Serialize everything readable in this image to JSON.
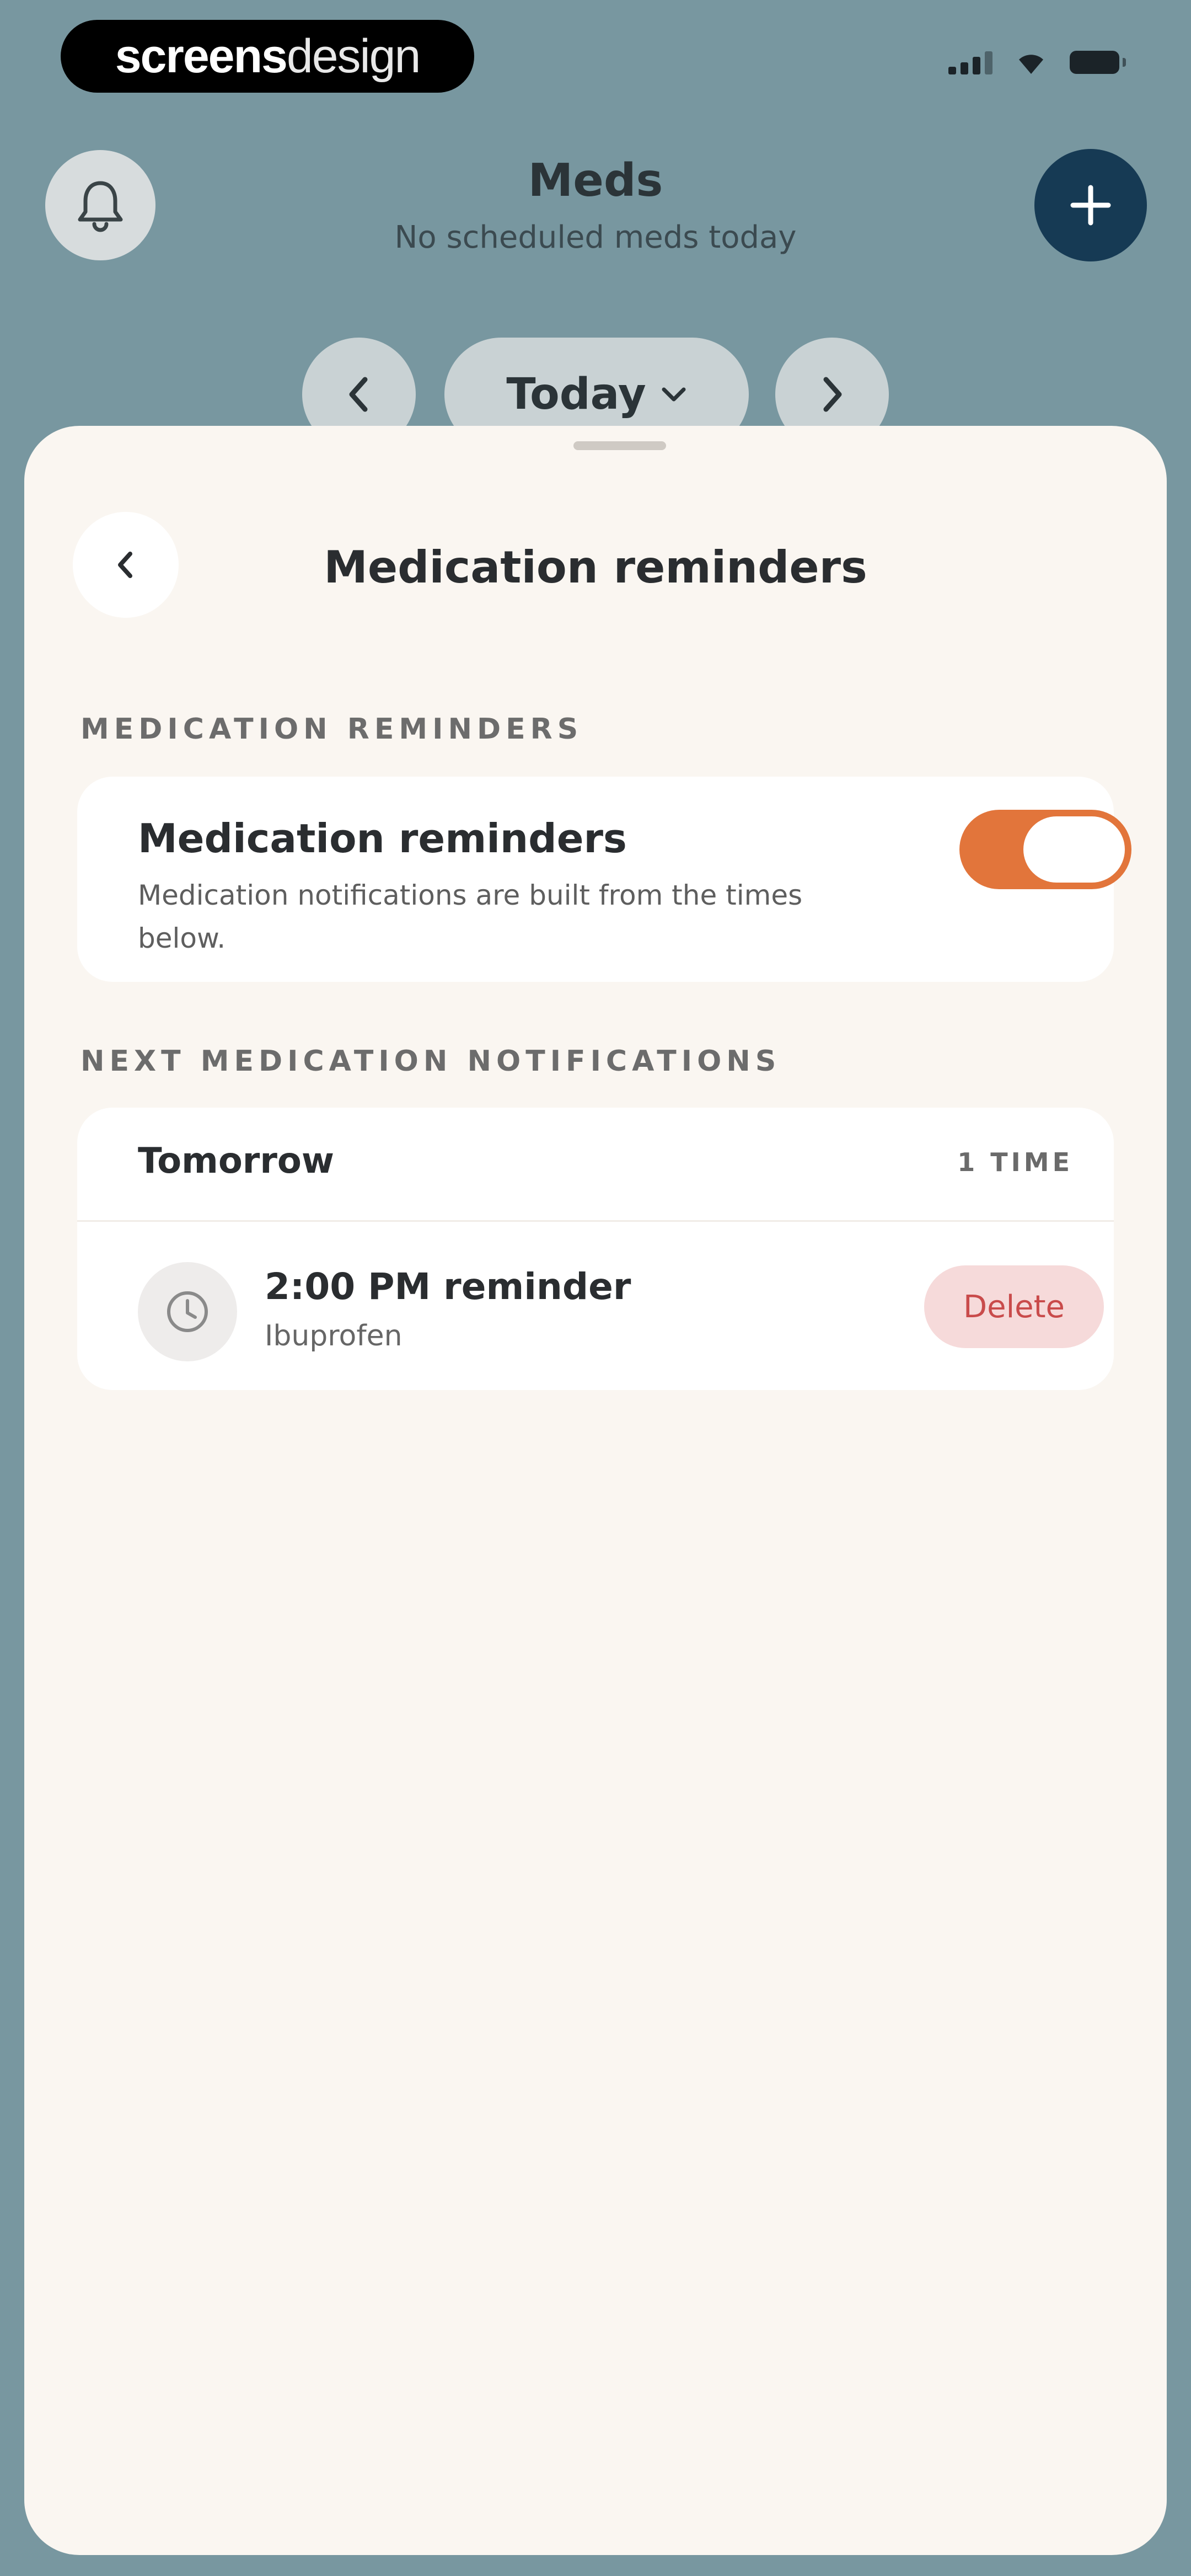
{
  "watermark": {
    "part1": "screens",
    "part2": "design"
  },
  "header": {
    "title": "Meds",
    "subtitle": "No scheduled meds today",
    "date_label": "Today"
  },
  "sheet": {
    "title": "Medication reminders",
    "reminders_section_label": "MEDICATION REMINDERS",
    "reminders_toggle": {
      "title": "Medication reminders",
      "description": "Medication notifications are built from the times below.",
      "enabled": true
    },
    "next_section_label": "NEXT MEDICATION NOTIFICATIONS",
    "day_group": {
      "title": "Tomorrow",
      "count": "1 TIME",
      "items": [
        {
          "title": "2:00 PM reminder",
          "medication": "Ibuprofen",
          "action": "Delete"
        }
      ]
    }
  },
  "colors": {
    "background": "#7897a0",
    "sheet": "#faf6f1",
    "accent_toggle": "#e2753b",
    "add_button": "#163a54",
    "delete_bg": "#f6dada",
    "delete_text": "#c94b4b"
  },
  "icons": [
    "bell-icon",
    "plus-icon",
    "chevron-left-icon",
    "chevron-right-icon",
    "chevron-down-icon",
    "back-icon",
    "clock-icon",
    "signal-icon",
    "wifi-icon",
    "battery-icon"
  ]
}
